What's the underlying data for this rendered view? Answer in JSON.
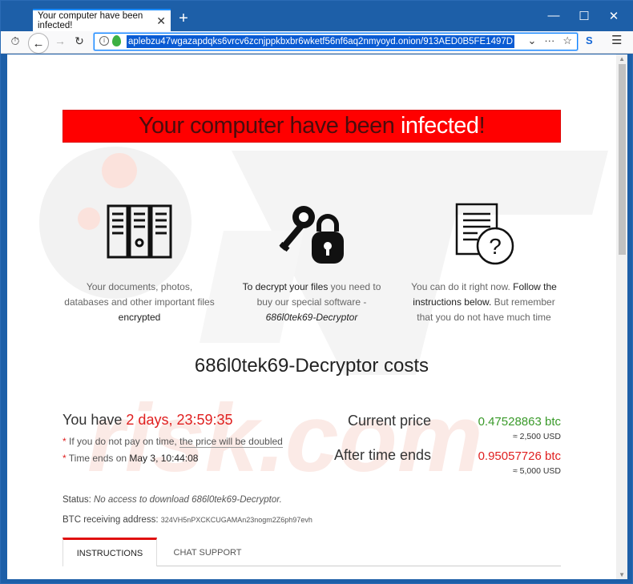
{
  "browser": {
    "tab_title": "Your computer have been infected!",
    "tab_close": "✕",
    "new_tab": "+",
    "url": "aplebzu47wgazapdqks6vrcv6zcnjppkbxbr6wketf56nf6aq2nmyoyd.onion/913AED0B5FE1497D",
    "extension_label": "S",
    "controls": {
      "minimize": "—",
      "maximize": "☐",
      "close": "✕"
    }
  },
  "page": {
    "banner": {
      "part1": "Your computer have been ",
      "part2": "infected",
      "part3": "!"
    },
    "features": [
      {
        "icon": "file-cabinet-icon",
        "line1": "Your documents, photos,",
        "line2": "databases and other important files",
        "line3": "encrypted"
      },
      {
        "icon": "key-lock-icon",
        "line1_bold": "To decrypt your files",
        "line1_rest": " you need to",
        "line2": "buy our special software -",
        "line3": "686l0tek69-Decryptor"
      },
      {
        "icon": "document-question-icon",
        "line1_rest": "You can do it right now. ",
        "line1_bold": "Follow the",
        "line2_bold": "instructions below.",
        "line2_rest": " But remember",
        "line3": "that you do not have much time"
      }
    ],
    "costs_title": "686l0tek69-Decryptor costs",
    "countdown": {
      "label": "You have ",
      "value": "2 days, 23:59:35"
    },
    "note1": {
      "star": "* ",
      "text": "If you do not pay on time, ",
      "link": "the price will be doubled"
    },
    "note2": {
      "star": "* ",
      "text": "Time ends on ",
      "value": "May 3, 10:44:08"
    },
    "current_price": {
      "label": "Current price",
      "btc": "0.47528863 btc",
      "usd": "≈ 2,500 USD"
    },
    "after_price": {
      "label": "After time ends",
      "btc": "0.95057726 btc",
      "usd": "≈ 5,000 USD"
    },
    "status": {
      "label": "Status: ",
      "value": "No access to download 686l0tek69-Decryptor."
    },
    "btc_address": {
      "label": "BTC receiving address: ",
      "value": "324VH5nPXCKCUGAMAn23nogm2Z6ph97evh"
    },
    "tabs": [
      "INSTRUCTIONS",
      "CHAT SUPPORT"
    ]
  },
  "colors": {
    "banner_red": "#ff0000",
    "green_price": "#3a9a2a",
    "red_price": "#e02020"
  }
}
